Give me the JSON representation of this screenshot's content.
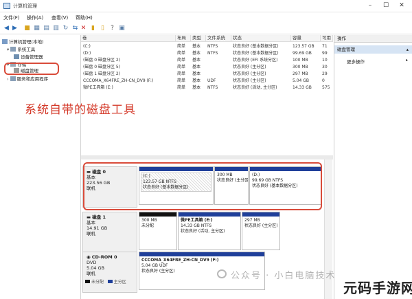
{
  "window": {
    "title": "计算机管理"
  },
  "menu": [
    "文件(F)",
    "操作(A)",
    "查看(V)",
    "帮助(H)"
  ],
  "tree": {
    "root": "计算机管理(本地)",
    "system_tools": "系统工具",
    "device_manager": "设备管理器",
    "storage": "存储",
    "disk_management": "磁盘管理",
    "services": "服务和应用程序"
  },
  "volumes": {
    "headers": [
      "卷",
      "布局",
      "类型",
      "文件系统",
      "状态",
      "容量",
      "可用"
    ],
    "rows": [
      [
        "(C:)",
        "简单",
        "基本",
        "NTFS",
        "状态良好 (基本数据分区)",
        "123.57 GB",
        "71"
      ],
      [
        "(D:)",
        "简单",
        "基本",
        "NTFS",
        "状态良好 (基本数据分区)",
        "99.69 GB",
        "99"
      ],
      [
        "(磁盘 0 磁盘分区 2)",
        "简单",
        "基本",
        "",
        "状态良好 (EFI 系统分区)",
        "100 MB",
        "10"
      ],
      [
        "(磁盘 0 磁盘分区 5)",
        "简单",
        "基本",
        "",
        "状态良好 (主分区)",
        "300 MB",
        "30"
      ],
      [
        "(磁盘 1 磁盘分区 2)",
        "简单",
        "基本",
        "",
        "状态良好 (主分区)",
        "297 MB",
        "29"
      ],
      [
        "CCCOMA_X64FRE_ZH-CN_DV9 (F:)",
        "简单",
        "基本",
        "UDF",
        "状态良好 (主分区)",
        "5.04 GB",
        "0"
      ],
      [
        "微PE工具箱 (E:)",
        "简单",
        "基本",
        "NTFS",
        "状态良好 (活动, 主分区)",
        "14.33 GB",
        "575"
      ]
    ]
  },
  "annotation": "系统自带的磁盘工具",
  "disks": [
    {
      "name": "磁盘 0",
      "type": "基本",
      "size": "223.56 GB",
      "status": "联机",
      "partitions": [
        {
          "name": "(C:)",
          "detail": "123.57 GB NTFS",
          "status": "状态良好 (基本数据分区)"
        },
        {
          "name": "",
          "detail": "300 MB",
          "status": "状态良好 (主分区)"
        },
        {
          "name": "(D:)",
          "detail": "99.69 GB NTFS",
          "status": "状态良好 (基本数据分区)"
        }
      ]
    },
    {
      "name": "磁盘 1",
      "type": "基本",
      "size": "14.91 GB",
      "status": "联机",
      "partitions": [
        {
          "name": "",
          "detail": "300 MB",
          "status": "未分配"
        },
        {
          "name": "微PE工具箱 (E:)",
          "detail": "14.33 GB NTFS",
          "status": "状态良好 (活动, 主分区)"
        },
        {
          "name": "",
          "detail": "297 MB",
          "status": "状态良好 (主分区)"
        }
      ]
    },
    {
      "name": "CD-ROM 0",
      "type": "DVD",
      "size": "5.04 GB",
      "status": "联机",
      "partitions": [
        {
          "name": "CCCOMA_X64FRE_ZH-CN_DV9 (F:)",
          "detail": "5.04 GB UDF",
          "status": "状态良好 (主分区)"
        }
      ]
    }
  ],
  "legend": [
    "未分配",
    "主分区"
  ],
  "actions": {
    "header": "操作",
    "section": "磁盘管理",
    "more": "更多操作"
  },
  "watermark": "公众号 · 小白电脑技术",
  "brand": "元码手游网",
  "colors": {
    "partition_bar": "#1f3f9a",
    "unallocated_bar": "#111111",
    "callout": "#d94b3a",
    "action_section": "#d6e4f4"
  }
}
